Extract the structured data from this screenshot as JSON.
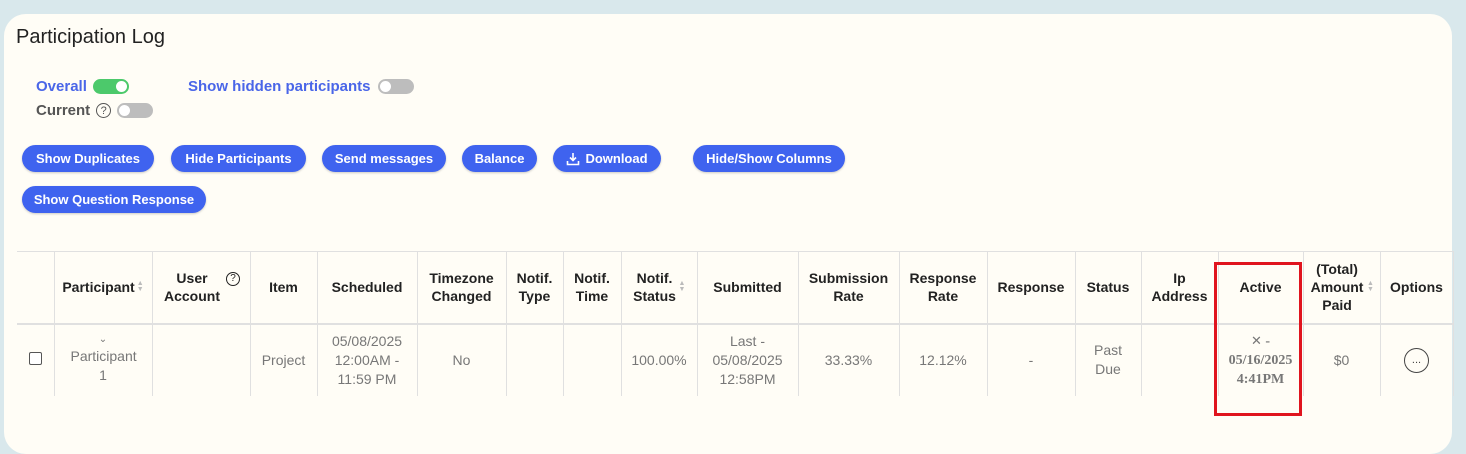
{
  "page": {
    "title": "Participation Log"
  },
  "toggles": {
    "overall": {
      "label": "Overall",
      "on": true
    },
    "current": {
      "label": "Current",
      "on": false
    },
    "hidden": {
      "label": "Show hidden participants",
      "on": false
    }
  },
  "buttons": {
    "show_duplicates": "Show Duplicates",
    "hide_participants": "Hide Participants",
    "send_messages": "Send messages",
    "balance": "Balance",
    "download": "Download",
    "hide_show_columns": "Hide/Show Columns",
    "show_question_response": "Show Question Response"
  },
  "table": {
    "headers": {
      "participant": "Participant",
      "user_account": "User Account",
      "item": "Item",
      "scheduled": "Scheduled",
      "timezone_changed": "Timezone Changed",
      "notif_type": "Notif. Type",
      "notif_time": "Notif. Time",
      "notif_status": "Notif. Status",
      "submitted": "Submitted",
      "submission_rate": "Submission Rate",
      "response_rate": "Response Rate",
      "response": "Response",
      "status": "Status",
      "ip_address": "Ip Address",
      "active": "Active",
      "amount_paid": "(Total) Amount Paid",
      "options": "Options"
    },
    "rows": [
      {
        "participant": "Participant 1",
        "user_account": "",
        "item": "Project",
        "scheduled": "05/08/2025 12:00AM - 11:59 PM",
        "timezone_changed": "No",
        "notif_type": "",
        "notif_time": "",
        "notif_status": "100.00%",
        "submitted": "Last - 05/08/2025 12:58PM",
        "submission_rate": "33.33%",
        "response_rate": "12.12%",
        "response": "-",
        "status": "Past Due",
        "ip_address": "",
        "active_date": "- 05/16/2025",
        "active_time": "4:41PM",
        "amount_paid": "$0",
        "options_glyph": "..."
      }
    ]
  }
}
